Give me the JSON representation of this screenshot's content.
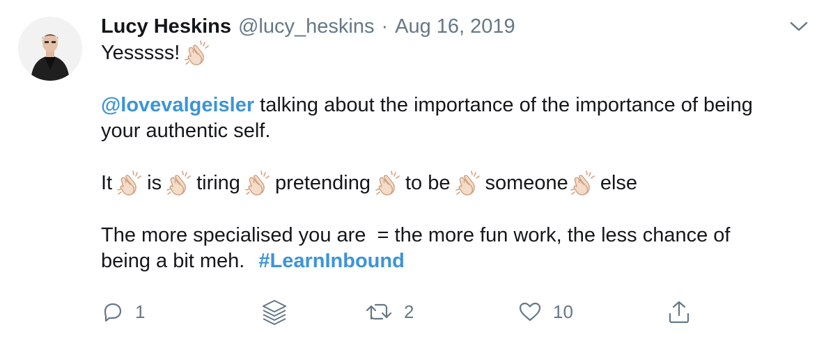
{
  "tweet": {
    "name": "Lucy Heskins",
    "handle": "@lucy_heskins",
    "separator": "·",
    "date": "Aug 16, 2019",
    "line1_text": "Yesssss!",
    "mention": "@lovevalgeisler",
    "line2_rest": " talking about the importance of the importance of being",
    "line3": "your authentic self.",
    "line4_words": [
      "It",
      "is",
      "tiring",
      "pretending",
      "to be",
      "someone",
      "else"
    ],
    "line5": "The more specialised you are  = the more fun work, the less chance of",
    "line6_text": "being a bit meh.",
    "hashtag": "#LearnInbound"
  },
  "actions": {
    "reply_count": "1",
    "retweet_count": "2",
    "like_count": "10"
  },
  "icons": {
    "emoji": "clapping-hands-icon",
    "reply": "reply-icon",
    "layers": "layers-icon",
    "retweet": "retweet-icon",
    "like": "heart-icon",
    "share": "share-icon",
    "menu": "chevron-down-icon"
  },
  "colors": {
    "link": "#3b94d9",
    "muted": "#657786",
    "text": "#14171a"
  }
}
